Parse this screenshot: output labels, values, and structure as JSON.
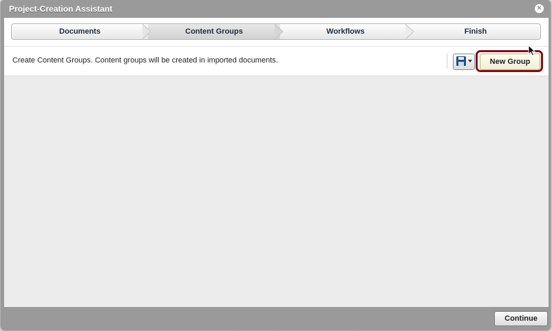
{
  "dialog": {
    "title": "Project-Creation Assistant"
  },
  "steps": [
    {
      "label": "Documents"
    },
    {
      "label": "Content Groups"
    },
    {
      "label": "Workflows"
    },
    {
      "label": "Finish"
    }
  ],
  "toolbar": {
    "instructions": "Create Content Groups. Content groups will be created in imported documents.",
    "new_group_label": "New Group"
  },
  "footer": {
    "continue_label": "Continue"
  },
  "icons": {
    "close": "close-icon",
    "save": "floppy-disk-icon",
    "dropdown": "chevron-down-icon",
    "cursor": "mouse-pointer-icon"
  },
  "colors": {
    "highlight_border": "#7d1319",
    "dialog_frame": "#9a9a9a",
    "content_bg": "#ececec"
  }
}
